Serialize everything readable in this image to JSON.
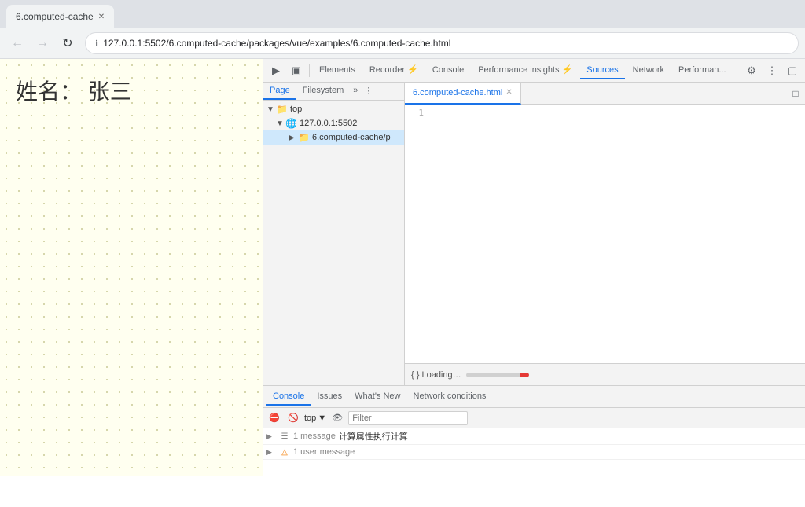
{
  "browser": {
    "tab_title": "6.computed-cache",
    "url": "127.0.0.1:5502/6.computed-cache/packages/vue/examples/6.computed-cache.html",
    "url_display": "127.0.0.1:5502/6.computed-cache/packages/vue/examples/6.computed-cache.html"
  },
  "page": {
    "content": "姓名： 张三"
  },
  "devtools": {
    "toolbar_tabs": [
      {
        "label": "Elements",
        "active": false
      },
      {
        "label": "Recorder ⚡",
        "active": false
      },
      {
        "label": "Console",
        "active": false
      },
      {
        "label": "Performance insights ⚡",
        "active": false
      },
      {
        "label": "Sources",
        "active": true
      },
      {
        "label": "Network",
        "active": false
      },
      {
        "label": "Performan...",
        "active": false
      }
    ],
    "sources": {
      "file_tree_tabs": [
        {
          "label": "Page",
          "active": true
        },
        {
          "label": "Filesystem",
          "active": false
        }
      ],
      "tree_items": [
        {
          "level": 0,
          "arrow": "▼",
          "icon": "folder",
          "label": "top",
          "selected": false
        },
        {
          "level": 1,
          "arrow": "▼",
          "icon": "globe",
          "label": "127.0.0.1:5502",
          "selected": false
        },
        {
          "level": 2,
          "arrow": "▶",
          "icon": "folder",
          "label": "6.computed-cache/p",
          "selected": true
        }
      ],
      "editor_tab": "6.computed-cache.html",
      "line_numbers": [
        "1"
      ],
      "loading_text": "{ } Loading…"
    },
    "console": {
      "tabs": [
        {
          "label": "Console",
          "active": true
        },
        {
          "label": "Issues",
          "active": false
        },
        {
          "label": "What's New",
          "active": false
        },
        {
          "label": "Network conditions",
          "active": false
        }
      ],
      "toolbar": {
        "top_label": "top",
        "filter_placeholder": "Filter"
      },
      "messages": [
        {
          "arrow": "▶",
          "icon": "list",
          "count": "1 message",
          "text": "计算属性执行计算",
          "type": "log"
        },
        {
          "arrow": "▶",
          "icon": "warning",
          "count": "1 user message",
          "text": "",
          "type": "user"
        }
      ]
    }
  }
}
